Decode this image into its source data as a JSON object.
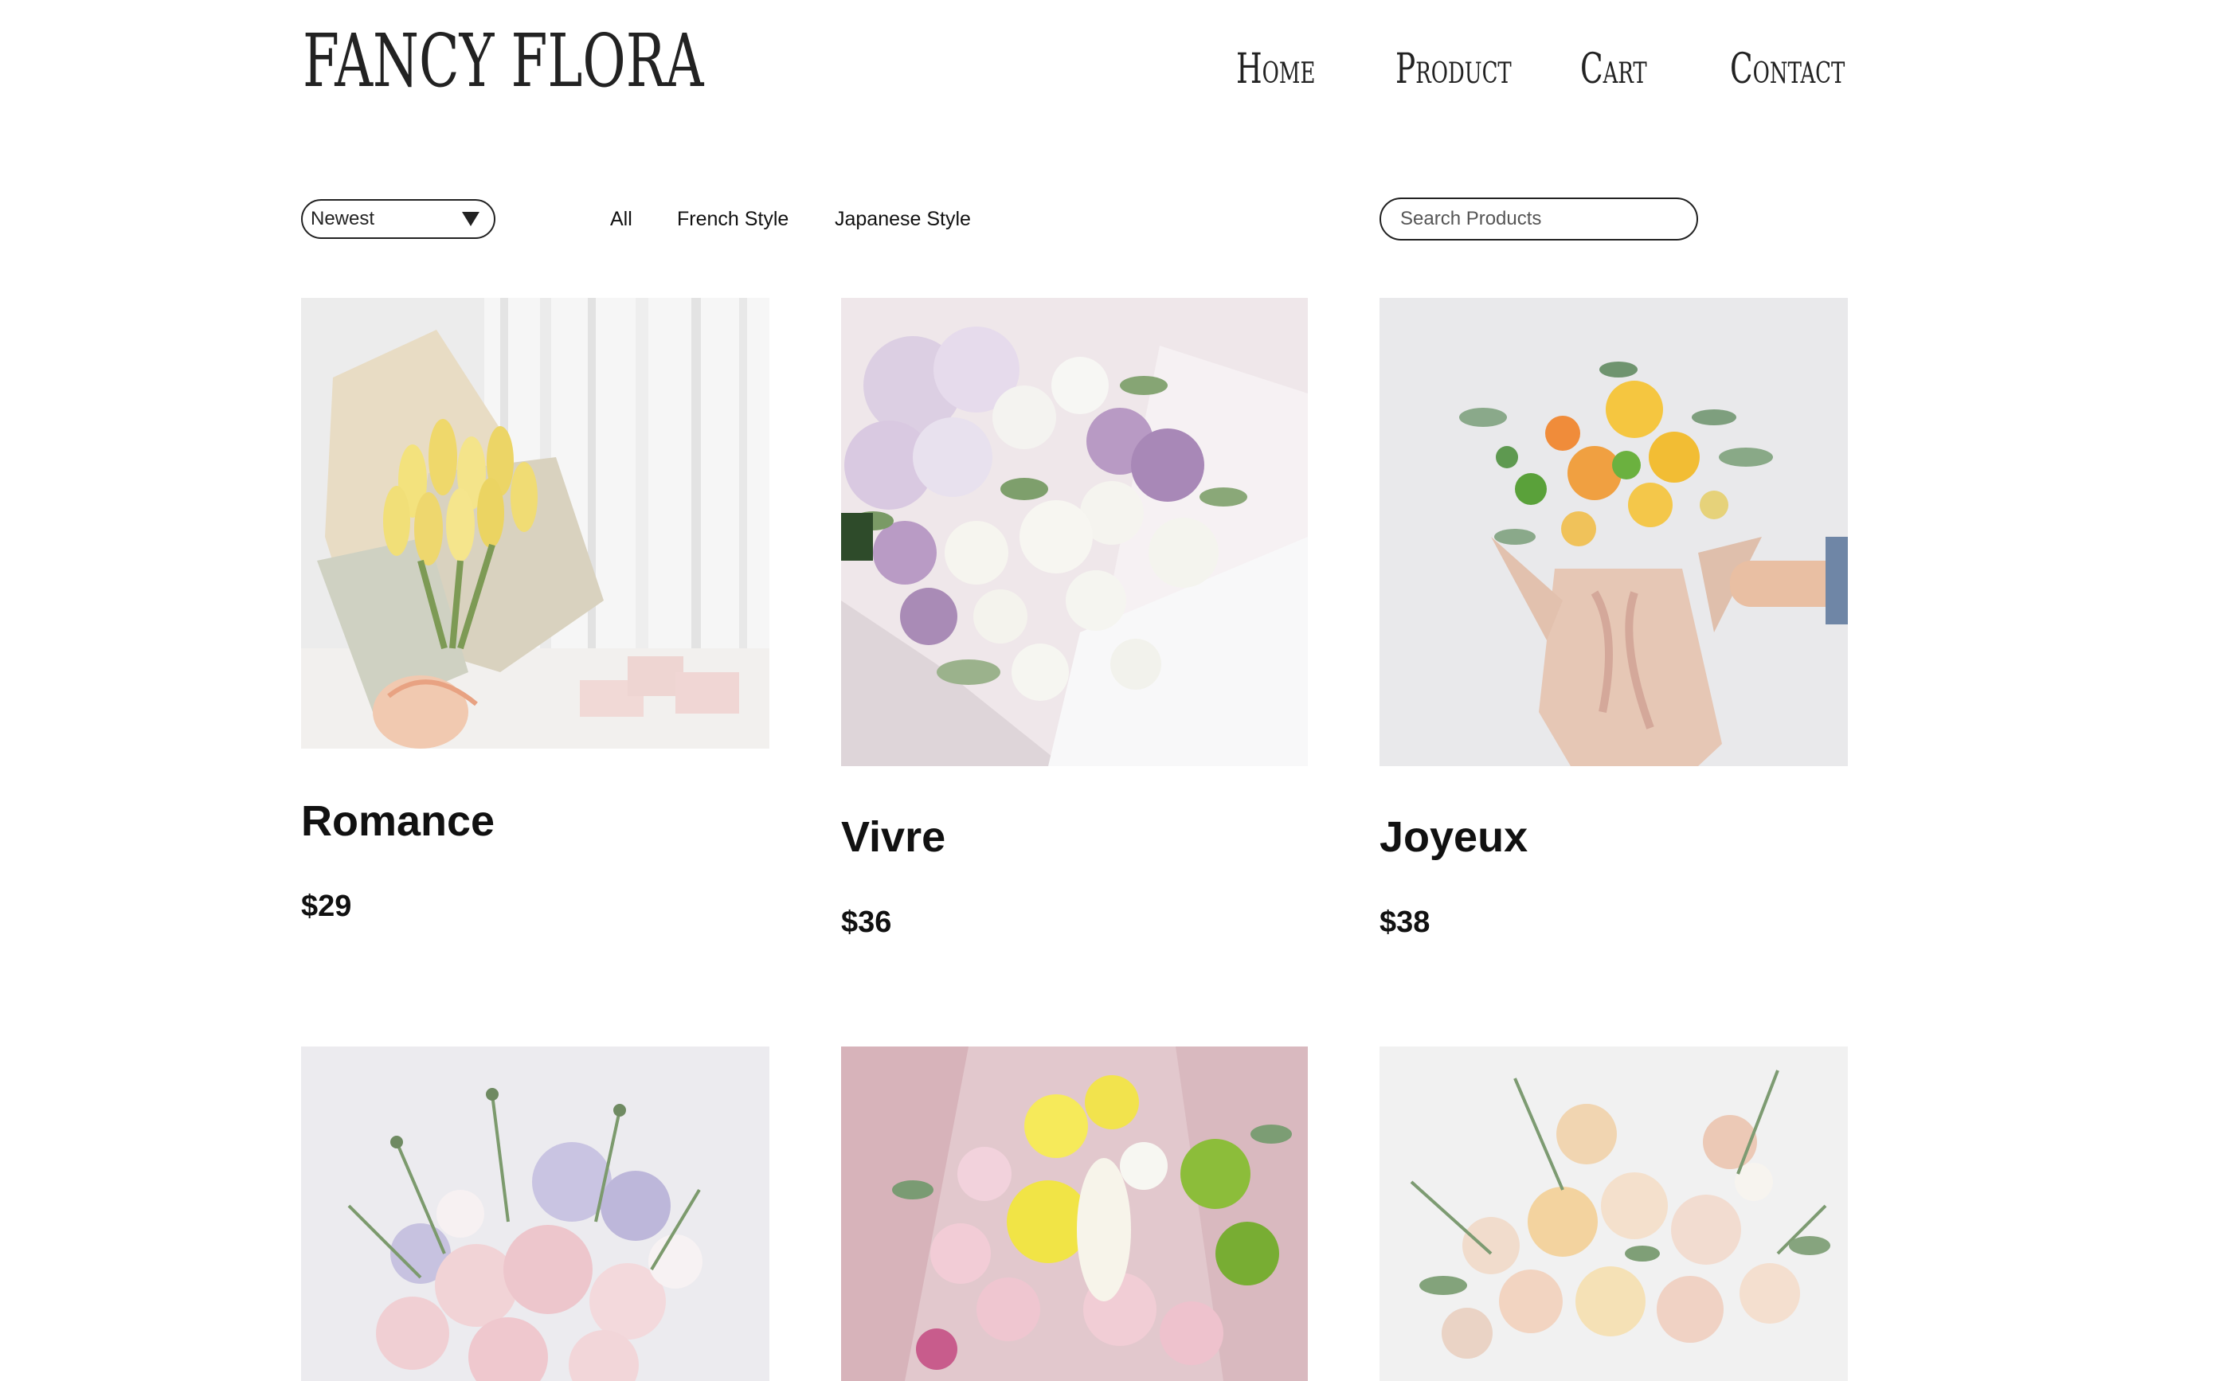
{
  "brand": {
    "logo_text": "FANCY FLORA"
  },
  "nav": {
    "items": [
      {
        "label": "Home"
      },
      {
        "label": "Product"
      },
      {
        "label": "Cart"
      },
      {
        "label": "Contact"
      }
    ]
  },
  "toolbar": {
    "sort_selected": "Newest",
    "filters": [
      {
        "label": "All"
      },
      {
        "label": "French Style"
      },
      {
        "label": "Japanese Style"
      }
    ],
    "search_placeholder": "Search Products"
  },
  "products": [
    {
      "name": "Romance",
      "price": "$29",
      "image_icon": "yellow-tulip-bouquet-photo"
    },
    {
      "name": "Vivre",
      "price": "$36",
      "image_icon": "lilac-white-rose-bouquet-photo"
    },
    {
      "name": "Joyeux",
      "price": "$38",
      "image_icon": "orange-yellow-bouquet-in-hand-photo"
    },
    {
      "name": "",
      "price": "",
      "image_icon": "pink-rose-wildflower-bouquet-photo"
    },
    {
      "name": "",
      "price": "",
      "image_icon": "yellow-pink-mixed-bouquet-photo"
    },
    {
      "name": "",
      "price": "",
      "image_icon": "peach-rose-bouquet-photo"
    }
  ],
  "colors": {
    "text": "#111111",
    "border": "#222222",
    "background": "#ffffff"
  }
}
